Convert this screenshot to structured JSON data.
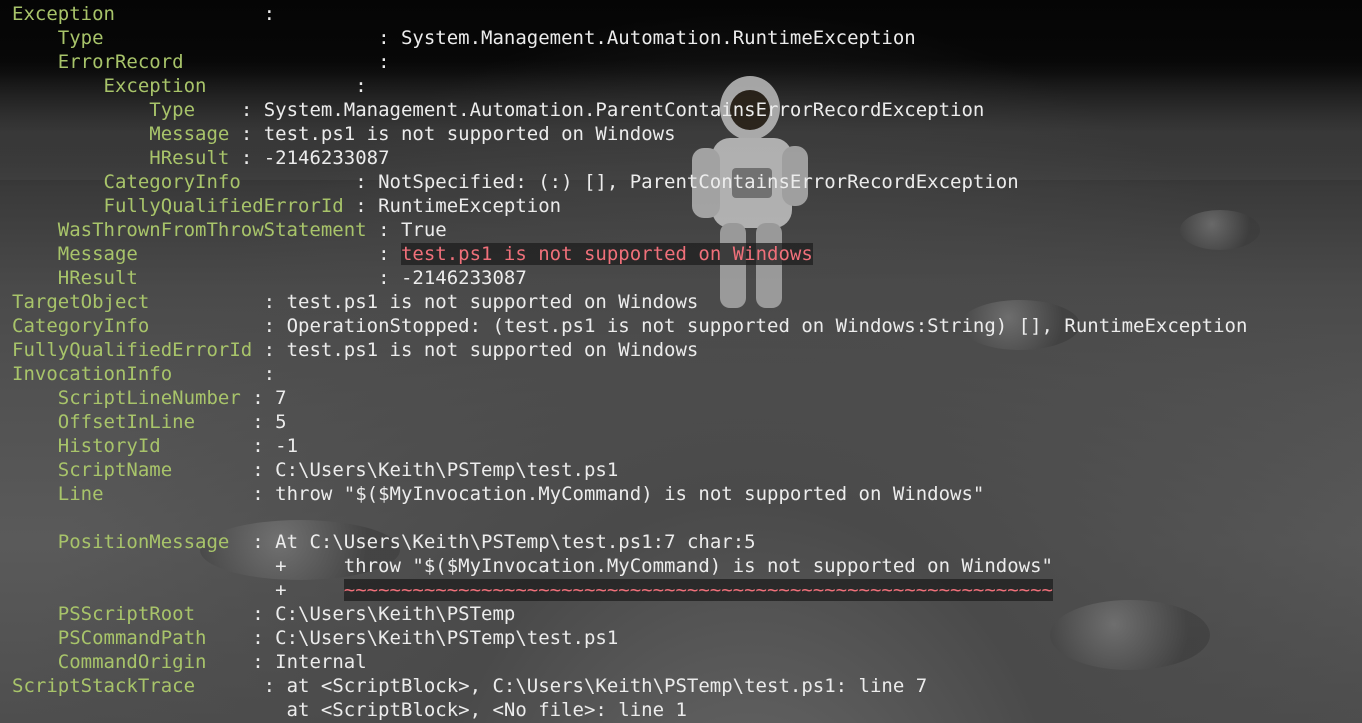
{
  "lines": [
    {
      "indent": "",
      "key": "Exception",
      "pad": "             ",
      "sep": ":",
      "value": ""
    },
    {
      "indent": "    ",
      "key": "Type",
      "pad": "                        ",
      "sep": ":",
      "value": " System.Management.Automation.RuntimeException"
    },
    {
      "indent": "    ",
      "key": "ErrorRecord",
      "pad": "                 ",
      "sep": ":",
      "value": ""
    },
    {
      "indent": "        ",
      "key": "Exception",
      "pad": "             ",
      "sep": ":",
      "value": ""
    },
    {
      "indent": "            ",
      "key": "Type",
      "pad": "    ",
      "sep": ":",
      "value": " System.Management.Automation.ParentContainsErrorRecordException"
    },
    {
      "indent": "            ",
      "key": "Message",
      "pad": " ",
      "sep": ":",
      "value": " test.ps1 is not supported on Windows"
    },
    {
      "indent": "            ",
      "key": "HResult",
      "pad": " ",
      "sep": ":",
      "value": " -2146233087"
    },
    {
      "indent": "        ",
      "key": "CategoryInfo",
      "pad": "          ",
      "sep": ":",
      "value": " NotSpecified: (:) [], ParentContainsErrorRecordException"
    },
    {
      "indent": "        ",
      "key": "FullyQualifiedErrorId",
      "pad": " ",
      "sep": ":",
      "value": " RuntimeException"
    },
    {
      "indent": "    ",
      "key": "WasThrownFromThrowStatement",
      "pad": " ",
      "sep": ":",
      "value": " True"
    },
    {
      "indent": "    ",
      "key": "Message",
      "pad": "                     ",
      "sep": ":",
      "value": "",
      "error": "test.ps1 is not supported on Windows"
    },
    {
      "indent": "    ",
      "key": "HResult",
      "pad": "                     ",
      "sep": ":",
      "value": " -2146233087"
    },
    {
      "indent": "",
      "key": "TargetObject",
      "pad": "          ",
      "sep": ":",
      "value": " test.ps1 is not supported on Windows"
    },
    {
      "indent": "",
      "key": "CategoryInfo",
      "pad": "          ",
      "sep": ":",
      "value": " OperationStopped: (test.ps1 is not supported on Windows:String) [], RuntimeException"
    },
    {
      "indent": "",
      "key": "FullyQualifiedErrorId",
      "pad": " ",
      "sep": ":",
      "value": " test.ps1 is not supported on Windows"
    },
    {
      "indent": "",
      "key": "InvocationInfo",
      "pad": "        ",
      "sep": ":",
      "value": ""
    },
    {
      "indent": "    ",
      "key": "ScriptLineNumber",
      "pad": " ",
      "sep": ":",
      "value": " 7"
    },
    {
      "indent": "    ",
      "key": "OffsetInLine",
      "pad": "     ",
      "sep": ":",
      "value": " 5"
    },
    {
      "indent": "    ",
      "key": "HistoryId",
      "pad": "        ",
      "sep": ":",
      "value": " -1"
    },
    {
      "indent": "    ",
      "key": "ScriptName",
      "pad": "       ",
      "sep": ":",
      "value": " C:\\Users\\Keith\\PSTemp\\test.ps1"
    },
    {
      "indent": "    ",
      "key": "Line",
      "pad": "             ",
      "sep": ":",
      "value": " throw \"$($MyInvocation.MyCommand) is not supported on Windows\""
    },
    {
      "indent": "",
      "key": "",
      "pad": "",
      "sep": "",
      "value": ""
    },
    {
      "indent": "    ",
      "key": "PositionMessage",
      "pad": "  ",
      "sep": ":",
      "value": " At C:\\Users\\Keith\\PSTemp\\test.ps1:7 char:5"
    },
    {
      "indent": "                       ",
      "key": "",
      "pad": "",
      "sep": "",
      "value": "+     throw \"$($MyInvocation.MyCommand) is not supported on Windows\""
    },
    {
      "indent": "                       ",
      "key": "",
      "pad": "",
      "sep": "",
      "value": "+     ",
      "squiggle": "~~~~~~~~~~~~~~~~~~~~~~~~~~~~~~~~~~~~~~~~~~~~~~~~~~~~~~~~~~~~~~"
    },
    {
      "indent": "    ",
      "key": "PSScriptRoot",
      "pad": "     ",
      "sep": ":",
      "value": " C:\\Users\\Keith\\PSTemp"
    },
    {
      "indent": "    ",
      "key": "PSCommandPath",
      "pad": "    ",
      "sep": ":",
      "value": " C:\\Users\\Keith\\PSTemp\\test.ps1"
    },
    {
      "indent": "    ",
      "key": "CommandOrigin",
      "pad": "    ",
      "sep": ":",
      "value": " Internal"
    },
    {
      "indent": "",
      "key": "ScriptStackTrace",
      "pad": "      ",
      "sep": ":",
      "value": " at <ScriptBlock>, C:\\Users\\Keith\\PSTemp\\test.ps1: line 7"
    },
    {
      "indent": "                        ",
      "key": "",
      "pad": "",
      "sep": "",
      "value": "at <ScriptBlock>, <No file>: line 1"
    }
  ]
}
